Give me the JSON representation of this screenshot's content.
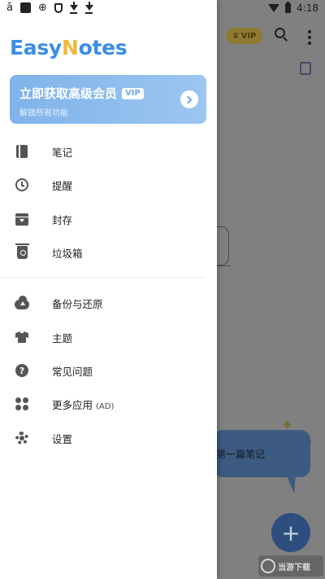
{
  "status_bar": {
    "time": "4:18",
    "left_icons": [
      "notification-icon",
      "app-icon",
      "sim-icon",
      "shield-icon",
      "download-icon",
      "download-icon"
    ],
    "right_icons": [
      "wifi-icon",
      "battery-icon"
    ]
  },
  "background": {
    "vip_label": "VIP",
    "empty_hint": "第一篇笔记",
    "fab_label": "+",
    "watermark_text": "当游下载"
  },
  "drawer": {
    "logo": {
      "part1": "Easy",
      "part2": "N",
      "part3": "otes"
    },
    "promo": {
      "title": "立即获取高级会员",
      "badge": "VIP",
      "subtitle": "解锁所有功能"
    },
    "items": [
      {
        "label": "笔记",
        "icon": "notes-icon"
      },
      {
        "label": "提醒",
        "icon": "alarm-icon"
      },
      {
        "label": "封存",
        "icon": "archive-icon"
      },
      {
        "label": "垃圾箱",
        "icon": "trash-icon"
      },
      {
        "label": "备份与还原",
        "icon": "cloud-upload-icon"
      },
      {
        "label": "主题",
        "icon": "shirt-icon"
      },
      {
        "label": "常见问题",
        "icon": "help-icon"
      },
      {
        "label": "更多应用",
        "suffix": "(AD)",
        "icon": "apps-icon"
      },
      {
        "label": "设置",
        "icon": "settings-icon"
      }
    ]
  },
  "colors": {
    "brand_blue": "#3a8ee6",
    "brand_yellow": "#f3b63a",
    "promo_start": "#7fb3ea",
    "promo_end": "#9cc6f0",
    "icon_gray": "#555555",
    "scrim": "#808080"
  }
}
